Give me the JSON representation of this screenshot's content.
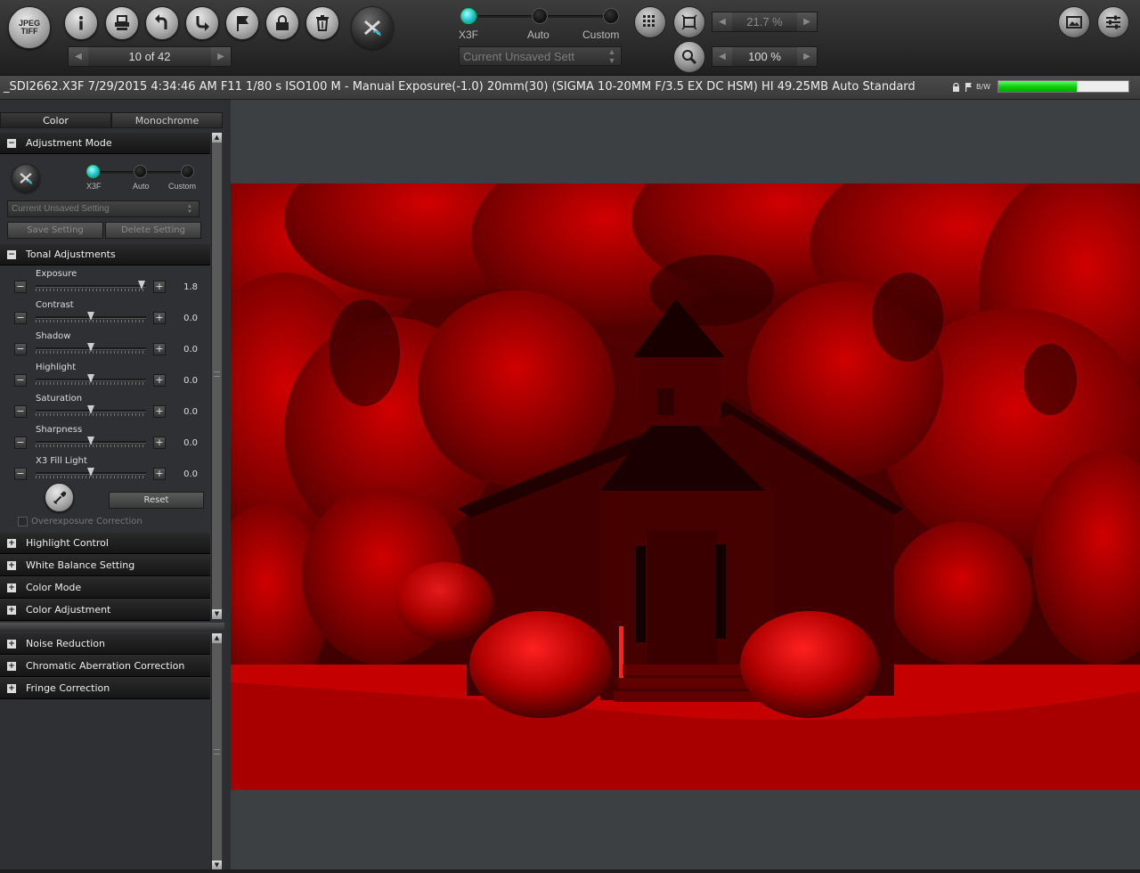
{
  "toolbar": {
    "jpeg_tiff": [
      "JPEG",
      "TIFF"
    ],
    "buttons": [
      "info-icon",
      "print-icon",
      "rotate-left-icon",
      "rotate-right-icon",
      "flag-icon",
      "lock-icon",
      "trash-icon",
      "x3-logo-icon"
    ],
    "nav_counter": "10 of 42",
    "mode_labels": [
      "X3F",
      "Auto",
      "Custom"
    ],
    "mode_selected": "X3F",
    "setting_select": "Current Unsaved Sett",
    "zoom_fit": "21.7 %",
    "zoom_actual": "100 %",
    "right_icons": [
      "slideshow-icon",
      "adjust-panel-icon"
    ]
  },
  "infobar": {
    "file_info": "_SDI2662.X3F 7/29/2015 4:34:46 AM F11 1/80 s ISO100 M - Manual Exposure(-1.0) 20mm(30) (SIGMA 10-20MM F/3.5 EX DC HSM) HI 49.25MB Auto Standard",
    "bw_label": "B/W",
    "progress_fraction": 0.6
  },
  "panel": {
    "tabs": [
      "Color",
      "Monochrome"
    ],
    "active_tab": "Color",
    "adjustment_mode": {
      "title": "Adjustment Mode",
      "mode_labels": [
        "X3F",
        "Auto",
        "Custom"
      ],
      "selected": "X3F",
      "setting_select": "Current Unsaved Setting",
      "save_label": "Save Setting",
      "delete_label": "Delete Setting"
    },
    "tonal": {
      "title": "Tonal Adjustments",
      "sliders": [
        {
          "label": "Exposure",
          "value": "1.8",
          "fraction": 0.96
        },
        {
          "label": "Contrast",
          "value": "0.0",
          "fraction": 0.5
        },
        {
          "label": "Shadow",
          "value": "0.0",
          "fraction": 0.5
        },
        {
          "label": "Highlight",
          "value": "0.0",
          "fraction": 0.5
        },
        {
          "label": "Saturation",
          "value": "0.0",
          "fraction": 0.5
        },
        {
          "label": "Sharpness",
          "value": "0.0",
          "fraction": 0.5
        },
        {
          "label": "X3 Fill Light",
          "value": "0.0",
          "fraction": 0.5
        }
      ],
      "minus": "−",
      "plus": "+",
      "reset_label": "Reset",
      "overexposure_label": "Overexposure Correction"
    },
    "collapsed_sections": [
      "Highlight Control",
      "White Balance Setting",
      "Color Mode",
      "Color Adjustment"
    ],
    "lower_sections": [
      "Noise Reduction",
      "Chromatic Aberration Correction",
      "Fringe Correction"
    ],
    "collapse_glyph": "−",
    "expand_glyph": "+"
  },
  "colors": {
    "accent_cyan": "#1bb8c8",
    "progress_green": "#22cc22",
    "photo_red": "#b00000"
  }
}
